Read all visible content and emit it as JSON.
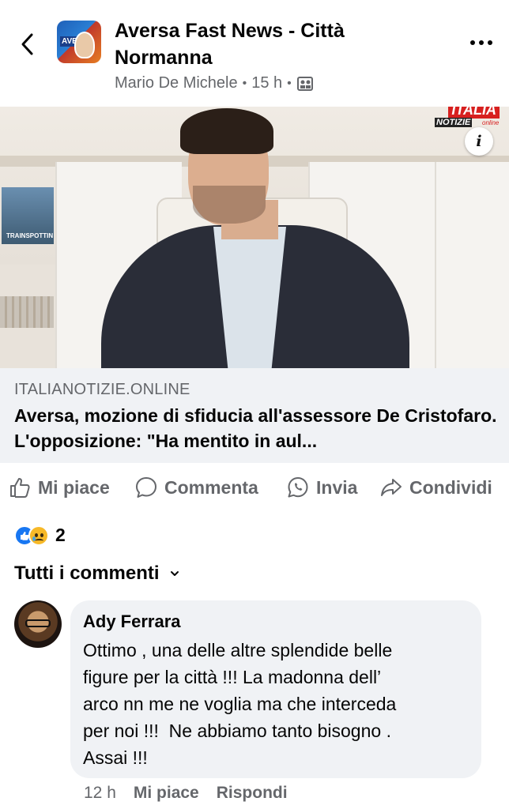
{
  "header": {
    "page_name": "Aversa Fast News - Città Normanna",
    "author": "Mario De Michele",
    "time": "15 h",
    "separator": "•",
    "avatar_text": "AVE"
  },
  "image": {
    "logo_top": "ITALIA",
    "logo_mid": "NOTIZIE",
    "logo_small": "online",
    "poster_text": "TRAINSPOTTIN",
    "info_label": "i"
  },
  "link": {
    "domain": "ITALIANOTIZIE.ONLINE",
    "headline": "Aversa, mozione di sfiducia all'assessore De Cristofaro. L'opposizione: \"Ha mentito in aul..."
  },
  "actions": {
    "like": "Mi piace",
    "comment": "Commenta",
    "send": "Invia",
    "share": "Condividi"
  },
  "reactions": {
    "count": "2"
  },
  "comments_header": {
    "label": "Tutti i commenti"
  },
  "comment": {
    "author": "Ady Ferrara",
    "text": "Ottimo , una delle altre splendide belle\nfigure per la città !!! La madonna dell’\narco nn me ne voglia ma che interceda\nper noi !!!  Ne abbiamo tanto bisogno .\nAssai !!!",
    "time": "12 h",
    "like": "Mi piace",
    "reply": "Rispondi"
  },
  "colors": {
    "primary_text": "#050505",
    "secondary_text": "#65676b",
    "surface": "#f0f2f5",
    "like_blue": "#1877f2",
    "sad_yellow": "#f7b928"
  },
  "icons": [
    "back-arrow-icon",
    "more-dots-icon",
    "album-icon",
    "info-icon",
    "thumbs-up-icon",
    "comment-bubble-icon",
    "whatsapp-icon",
    "share-arrow-icon",
    "like-reaction-icon",
    "sad-reaction-icon",
    "chevron-down-icon"
  ]
}
